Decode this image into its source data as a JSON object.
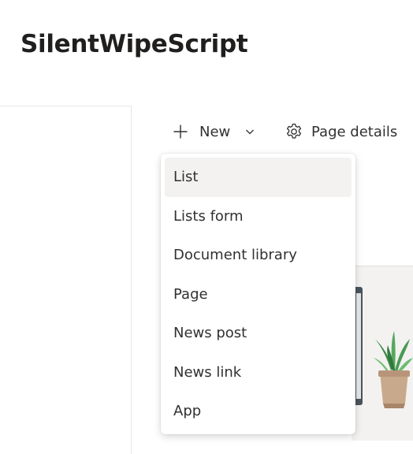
{
  "site": {
    "title": "SilentWipeScript"
  },
  "command_bar": {
    "new_label": "New",
    "new_icon": "plus-icon",
    "new_chevron_icon": "chevron-down-icon",
    "page_details_label": "Page details",
    "page_details_icon": "gear-icon"
  },
  "new_menu": {
    "items": [
      {
        "label": "List",
        "highlighted": true
      },
      {
        "label": "Lists form",
        "highlighted": false
      },
      {
        "label": "Document library",
        "highlighted": false
      },
      {
        "label": "Page",
        "highlighted": false
      },
      {
        "label": "News post",
        "highlighted": false
      },
      {
        "label": "News link",
        "highlighted": false
      },
      {
        "label": "App",
        "highlighted": false
      }
    ]
  },
  "colors": {
    "text": "#323130",
    "title": "#201f1e",
    "menu_hover": "#f3f2f1"
  }
}
